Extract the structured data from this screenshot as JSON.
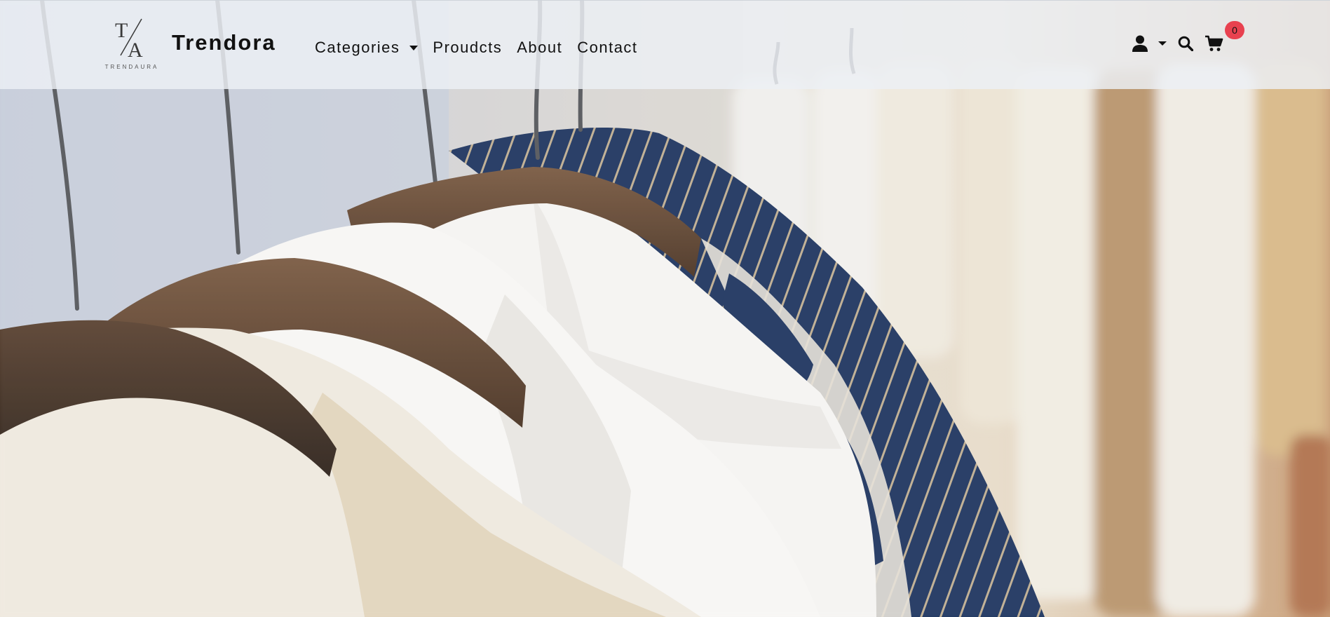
{
  "brand": {
    "logo_mark": "TA",
    "logo_wordmark": "TRENDAURA",
    "name": "Trendora"
  },
  "nav": {
    "items": [
      {
        "label": "Categories",
        "has_dropdown": true
      },
      {
        "label": "Proudcts"
      },
      {
        "label": "About"
      },
      {
        "label": "Contact"
      }
    ]
  },
  "tools": {
    "account_icon": "user-icon",
    "search_icon": "search-icon",
    "cart_icon": "cart-icon",
    "cart_count": "0"
  },
  "colors": {
    "header_bg": "#eceff4",
    "badge": "#e8414f",
    "text": "#111111"
  },
  "hero": {
    "image": "photo-of-shirts-on-wooden-hangers"
  }
}
